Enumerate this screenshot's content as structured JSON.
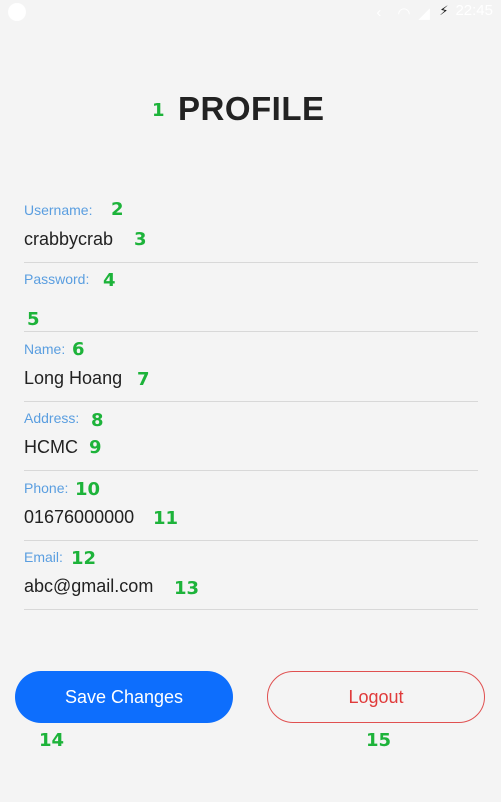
{
  "status_bar": {
    "time": "22:45",
    "icons": [
      "app-icon",
      "back-arrow-icon",
      "wifi-icon",
      "signal-icon",
      "charging-icon"
    ]
  },
  "title": "PROFILE",
  "fields": [
    {
      "label": "Username:",
      "value": "crabbycrab"
    },
    {
      "label": "Password:",
      "value": ""
    },
    {
      "label": "Name:",
      "value": "Long Hoang"
    },
    {
      "label": "Address:",
      "value": "HCMC"
    },
    {
      "label": "Phone:",
      "value": "01676000000"
    },
    {
      "label": "Email:",
      "value": "abc@gmail.com"
    }
  ],
  "buttons": {
    "save_label": "Save Changes",
    "logout_label": "Logout"
  },
  "markers": [
    "1",
    "2",
    "3",
    "4",
    "5",
    "6",
    "7",
    "8",
    "9",
    "10",
    "11",
    "12",
    "13",
    "14",
    "15"
  ],
  "colors": {
    "primary": "#0d6efd",
    "danger": "#e03a3a",
    "label": "#5a9ee0",
    "marker": "#1db33a"
  }
}
